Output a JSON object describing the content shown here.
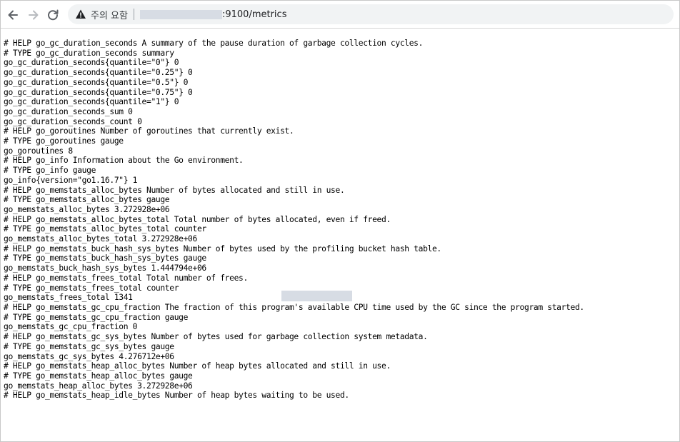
{
  "browser": {
    "security_label": "주의 요함",
    "url": ":9100/metrics",
    "icons": {
      "back": "back-arrow-icon",
      "forward": "forward-arrow-icon",
      "reload": "reload-icon",
      "warning": "warning-triangle-icon"
    }
  },
  "metrics": [
    "# HELP go_gc_duration_seconds A summary of the pause duration of garbage collection cycles.",
    "# TYPE go_gc_duration_seconds summary",
    "go_gc_duration_seconds{quantile=\"0\"} 0",
    "go_gc_duration_seconds{quantile=\"0.25\"} 0",
    "go_gc_duration_seconds{quantile=\"0.5\"} 0",
    "go_gc_duration_seconds{quantile=\"0.75\"} 0",
    "go_gc_duration_seconds{quantile=\"1\"} 0",
    "go_gc_duration_seconds_sum 0",
    "go_gc_duration_seconds_count 0",
    "# HELP go_goroutines Number of goroutines that currently exist.",
    "# TYPE go_goroutines gauge",
    "go_goroutines 8",
    "# HELP go_info Information about the Go environment.",
    "# TYPE go_info gauge",
    "go_info{version=\"go1.16.7\"} 1",
    "# HELP go_memstats_alloc_bytes Number of bytes allocated and still in use.",
    "# TYPE go_memstats_alloc_bytes gauge",
    "go_memstats_alloc_bytes 3.272928e+06",
    "# HELP go_memstats_alloc_bytes_total Total number of bytes allocated, even if freed.",
    "# TYPE go_memstats_alloc_bytes_total counter",
    "go_memstats_alloc_bytes_total 3.272928e+06",
    "# HELP go_memstats_buck_hash_sys_bytes Number of bytes used by the profiling bucket hash table.",
    "# TYPE go_memstats_buck_hash_sys_bytes gauge",
    "go_memstats_buck_hash_sys_bytes 1.444794e+06",
    "# HELP go_memstats_frees_total Total number of frees.",
    "# TYPE go_memstats_frees_total counter",
    "go_memstats_frees_total 1341",
    "# HELP go_memstats_gc_cpu_fraction The fraction of this program's available CPU time used by the GC since the program started.",
    "# TYPE go_memstats_gc_cpu_fraction gauge",
    "go_memstats_gc_cpu_fraction 0",
    "# HELP go_memstats_gc_sys_bytes Number of bytes used for garbage collection system metadata.",
    "# TYPE go_memstats_gc_sys_bytes gauge",
    "go_memstats_gc_sys_bytes 4.276712e+06",
    "# HELP go_memstats_heap_alloc_bytes Number of heap bytes allocated and still in use.",
    "# TYPE go_memstats_heap_alloc_bytes gauge",
    "go_memstats_heap_alloc_bytes 3.272928e+06",
    "# HELP go_memstats_heap_idle_bytes Number of heap bytes waiting to be used."
  ]
}
